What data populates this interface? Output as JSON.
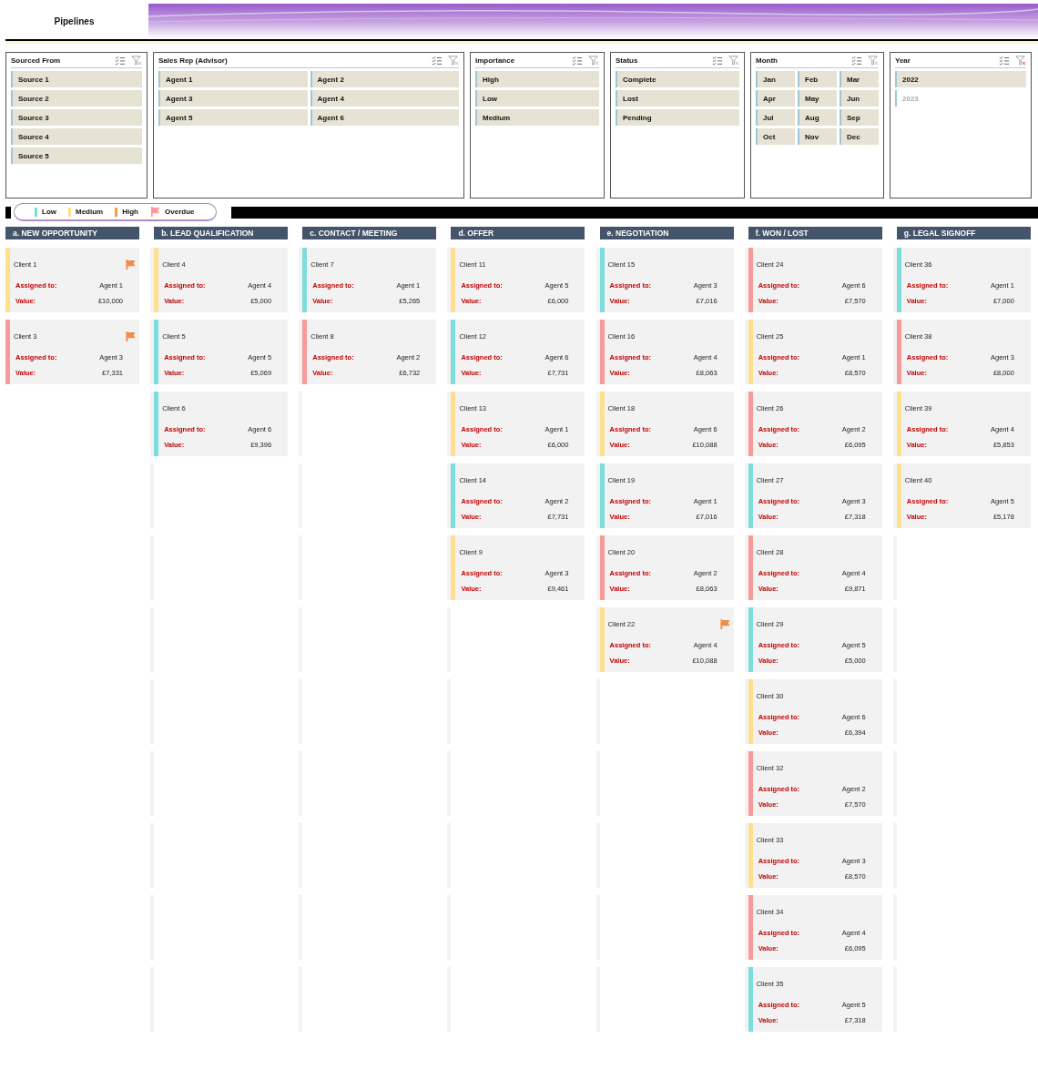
{
  "title": "Pipelines",
  "slicers": [
    {
      "title": "Sourced From",
      "filtered": false,
      "items": [
        {
          "label": "Source 1",
          "selected": true
        },
        {
          "label": "Source 2",
          "selected": true
        },
        {
          "label": "Source 3",
          "selected": true
        },
        {
          "label": "Source 4",
          "selected": true
        },
        {
          "label": "Source 5",
          "selected": true
        }
      ]
    },
    {
      "title": "Sales Rep (Advisor)",
      "filtered": false,
      "items": [
        {
          "label": "Agent 1",
          "selected": true
        },
        {
          "label": "Agent 2",
          "selected": true
        },
        {
          "label": "Agent 3",
          "selected": true
        },
        {
          "label": "Agent 4",
          "selected": true
        },
        {
          "label": "Agent 5",
          "selected": true
        },
        {
          "label": "Agent 6",
          "selected": true
        }
      ]
    },
    {
      "title": "Importance",
      "filtered": false,
      "items": [
        {
          "label": "High",
          "selected": true
        },
        {
          "label": "Low",
          "selected": true
        },
        {
          "label": "Medium",
          "selected": true
        }
      ]
    },
    {
      "title": "Status",
      "filtered": false,
      "items": [
        {
          "label": "Complete",
          "selected": true
        },
        {
          "label": "Lost",
          "selected": true
        },
        {
          "label": "Pending",
          "selected": true
        }
      ]
    },
    {
      "title": "Month",
      "filtered": false,
      "items": [
        {
          "label": "Jan",
          "selected": true
        },
        {
          "label": "Feb",
          "selected": true
        },
        {
          "label": "Mar",
          "selected": true
        },
        {
          "label": "Apr",
          "selected": true
        },
        {
          "label": "May",
          "selected": true
        },
        {
          "label": "Jun",
          "selected": true
        },
        {
          "label": "Jul",
          "selected": true
        },
        {
          "label": "Aug",
          "selected": true
        },
        {
          "label": "Sep",
          "selected": true
        },
        {
          "label": "Oct",
          "selected": true
        },
        {
          "label": "Nov",
          "selected": true
        },
        {
          "label": "Dec",
          "selected": true
        }
      ]
    },
    {
      "title": "Year",
      "filtered": true,
      "items": [
        {
          "label": "2022",
          "selected": true
        },
        {
          "label": "2023",
          "selected": false
        }
      ]
    }
  ],
  "legend": [
    {
      "kind": "bar",
      "label": "Low",
      "color": "#7ddcdc"
    },
    {
      "kind": "bar",
      "label": "Medium",
      "color": "#fde08e"
    },
    {
      "kind": "bar",
      "label": "High",
      "color": "#f59a4a"
    },
    {
      "kind": "flag",
      "label": "Overdue",
      "color": "#f79a9a"
    }
  ],
  "stages": [
    {
      "title": "a. NEW OPPORTUNITY",
      "cards": [
        {
          "client": "Client 1",
          "color": "#fde08e",
          "overdue": true,
          "assigned_label": "Assigned to:",
          "agent": "Agent 1",
          "value_label": "Value:",
          "value": "£10,000"
        },
        {
          "client": "Client 3",
          "color": "#f79a9a",
          "overdue": true,
          "assigned_label": "Assigned to:",
          "agent": "Agent 3",
          "value_label": "Value:",
          "value": "£7,331"
        }
      ]
    },
    {
      "title": "b. LEAD QUALIFICATION",
      "cards": [
        {
          "client": "Client 4",
          "color": "#fde08e",
          "overdue": false,
          "assigned_label": "Assigned to:",
          "agent": "Agent 4",
          "value_label": "Value:",
          "value": "£5,000"
        },
        {
          "client": "Client 5",
          "color": "#7ddcdc",
          "overdue": false,
          "assigned_label": "Assigned to:",
          "agent": "Agent 5",
          "value_label": "Value:",
          "value": "£5,069"
        },
        {
          "client": "Client 6",
          "color": "#7ddcdc",
          "overdue": false,
          "assigned_label": "Assigned to:",
          "agent": "Agent 6",
          "value_label": "Value:",
          "value": "£9,396"
        }
      ]
    },
    {
      "title": "c. CONTACT / MEETING",
      "cards": [
        {
          "client": "Client 7",
          "color": "#7ddcdc",
          "overdue": false,
          "assigned_label": "Assigned to:",
          "agent": "Agent 1",
          "value_label": "Value:",
          "value": "£5,265"
        },
        {
          "client": "Client 8",
          "color": "#f79a9a",
          "overdue": false,
          "assigned_label": "Assigned to:",
          "agent": "Agent 2",
          "value_label": "Value:",
          "value": "£6,732"
        }
      ]
    },
    {
      "title": "d. OFFER",
      "cards": [
        {
          "client": "Client 11",
          "color": "#fde08e",
          "overdue": false,
          "assigned_label": "Assigned to:",
          "agent": "Agent 5",
          "value_label": "Value:",
          "value": "£6,000"
        },
        {
          "client": "Client 12",
          "color": "#7ddcdc",
          "overdue": false,
          "assigned_label": "Assigned to:",
          "agent": "Agent 6",
          "value_label": "Value:",
          "value": "£7,731"
        },
        {
          "client": "Client 13",
          "color": "#fde08e",
          "overdue": false,
          "assigned_label": "Assigned to:",
          "agent": "Agent 1",
          "value_label": "Value:",
          "value": "£6,000"
        },
        {
          "client": "Client 14",
          "color": "#7ddcdc",
          "overdue": false,
          "assigned_label": "Assigned to:",
          "agent": "Agent 2",
          "value_label": "Value:",
          "value": "£7,731"
        },
        {
          "client": "Client 9",
          "color": "#fde08e",
          "overdue": false,
          "assigned_label": "Assigned to:",
          "agent": "Agent 3",
          "value_label": "Value:",
          "value": "£9,461"
        }
      ]
    },
    {
      "title": "e. NEGOTIATION",
      "cards": [
        {
          "client": "Client 15",
          "color": "#7ddcdc",
          "overdue": false,
          "assigned_label": "Assigned to:",
          "agent": "Agent 3",
          "value_label": "Value:",
          "value": "£7,016"
        },
        {
          "client": "Client 16",
          "color": "#f79a9a",
          "overdue": false,
          "assigned_label": "Assigned to:",
          "agent": "Agent 4",
          "value_label": "Value:",
          "value": "£8,063"
        },
        {
          "client": "Client 18",
          "color": "#fde08e",
          "overdue": false,
          "assigned_label": "Assigned to:",
          "agent": "Agent 6",
          "value_label": "Value:",
          "value": "£10,088"
        },
        {
          "client": "Client 19",
          "color": "#7ddcdc",
          "overdue": false,
          "assigned_label": "Assigned to:",
          "agent": "Agent 1",
          "value_label": "Value:",
          "value": "£7,016"
        },
        {
          "client": "Client 20",
          "color": "#f79a9a",
          "overdue": false,
          "assigned_label": "Assigned to:",
          "agent": "Agent 2",
          "value_label": "Value:",
          "value": "£8,063"
        },
        {
          "client": "Client 22",
          "color": "#fde08e",
          "overdue": true,
          "assigned_label": "Assigned to:",
          "agent": "Agent 4",
          "value_label": "Value:",
          "value": "£10,088"
        }
      ]
    },
    {
      "title": "f. WON / LOST",
      "cards": [
        {
          "client": "Client 24",
          "color": "#f79a9a",
          "overdue": false,
          "assigned_label": "Assigned to:",
          "agent": "Agent 6",
          "value_label": "Value:",
          "value": "£7,570"
        },
        {
          "client": "Client 25",
          "color": "#fde08e",
          "overdue": false,
          "assigned_label": "Assigned to:",
          "agent": "Agent 1",
          "value_label": "Value:",
          "value": "£8,570"
        },
        {
          "client": "Client 26",
          "color": "#f79a9a",
          "overdue": false,
          "assigned_label": "Assigned to:",
          "agent": "Agent 2",
          "value_label": "Value:",
          "value": "£6,095"
        },
        {
          "client": "Client 27",
          "color": "#7ddcdc",
          "overdue": false,
          "assigned_label": "Assigned to:",
          "agent": "Agent 3",
          "value_label": "Value:",
          "value": "£7,318"
        },
        {
          "client": "Client 28",
          "color": "#f79a9a",
          "overdue": false,
          "assigned_label": "Assigned to:",
          "agent": "Agent 4",
          "value_label": "Value:",
          "value": "£9,871"
        },
        {
          "client": "Client 29",
          "color": "#7ddcdc",
          "overdue": false,
          "assigned_label": "Assigned to:",
          "agent": "Agent 5",
          "value_label": "Value:",
          "value": "£5,000"
        },
        {
          "client": "Client 30",
          "color": "#fde08e",
          "overdue": false,
          "assigned_label": "Assigned to:",
          "agent": "Agent 6",
          "value_label": "Value:",
          "value": "£6,394"
        },
        {
          "client": "Client 32",
          "color": "#f79a9a",
          "overdue": false,
          "assigned_label": "Assigned to:",
          "agent": "Agent 2",
          "value_label": "Value:",
          "value": "£7,570"
        },
        {
          "client": "Client 33",
          "color": "#fde08e",
          "overdue": false,
          "assigned_label": "Assigned to:",
          "agent": "Agent 3",
          "value_label": "Value:",
          "value": "£8,570"
        },
        {
          "client": "Client 34",
          "color": "#f79a9a",
          "overdue": false,
          "assigned_label": "Assigned to:",
          "agent": "Agent 4",
          "value_label": "Value:",
          "value": "£6,095"
        },
        {
          "client": "Client 35",
          "color": "#7ddcdc",
          "overdue": false,
          "assigned_label": "Assigned to:",
          "agent": "Agent 5",
          "value_label": "Value:",
          "value": "£7,318"
        }
      ]
    },
    {
      "title": "g. LEGAL SIGNOFF",
      "cards": [
        {
          "client": "Client 36",
          "color": "#7ddcdc",
          "overdue": false,
          "assigned_label": "Assigned to:",
          "agent": "Agent 1",
          "value_label": "Value:",
          "value": "£7,000"
        },
        {
          "client": "Client 38",
          "color": "#f79a9a",
          "overdue": false,
          "assigned_label": "Assigned to:",
          "agent": "Agent 3",
          "value_label": "Value:",
          "value": "£8,000"
        },
        {
          "client": "Client 39",
          "color": "#fde08e",
          "overdue": false,
          "assigned_label": "Assigned to:",
          "agent": "Agent 4",
          "value_label": "Value:",
          "value": "£5,853"
        },
        {
          "client": "Client 40",
          "color": "#fde08e",
          "overdue": false,
          "assigned_label": "Assigned to:",
          "agent": "Agent 5",
          "value_label": "Value:",
          "value": "£5,178"
        }
      ]
    }
  ]
}
